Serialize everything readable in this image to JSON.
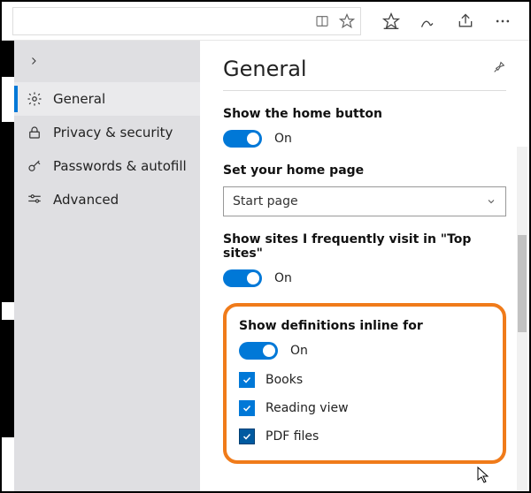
{
  "sidebar": {
    "items": [
      {
        "label": "General",
        "icon": "gear"
      },
      {
        "label": "Privacy & security",
        "icon": "lock"
      },
      {
        "label": "Passwords & autofill",
        "icon": "key"
      },
      {
        "label": "Advanced",
        "icon": "sliders"
      }
    ]
  },
  "panel": {
    "title": "General",
    "home_button": {
      "label": "Show the home button",
      "state": "On"
    },
    "home_page": {
      "label": "Set your home page",
      "value": "Start page"
    },
    "top_sites": {
      "label": "Show sites I frequently visit in \"Top sites\"",
      "state": "On"
    },
    "definitions": {
      "label": "Show definitions inline for",
      "state": "On",
      "opts": [
        "Books",
        "Reading view",
        "PDF files"
      ]
    }
  }
}
